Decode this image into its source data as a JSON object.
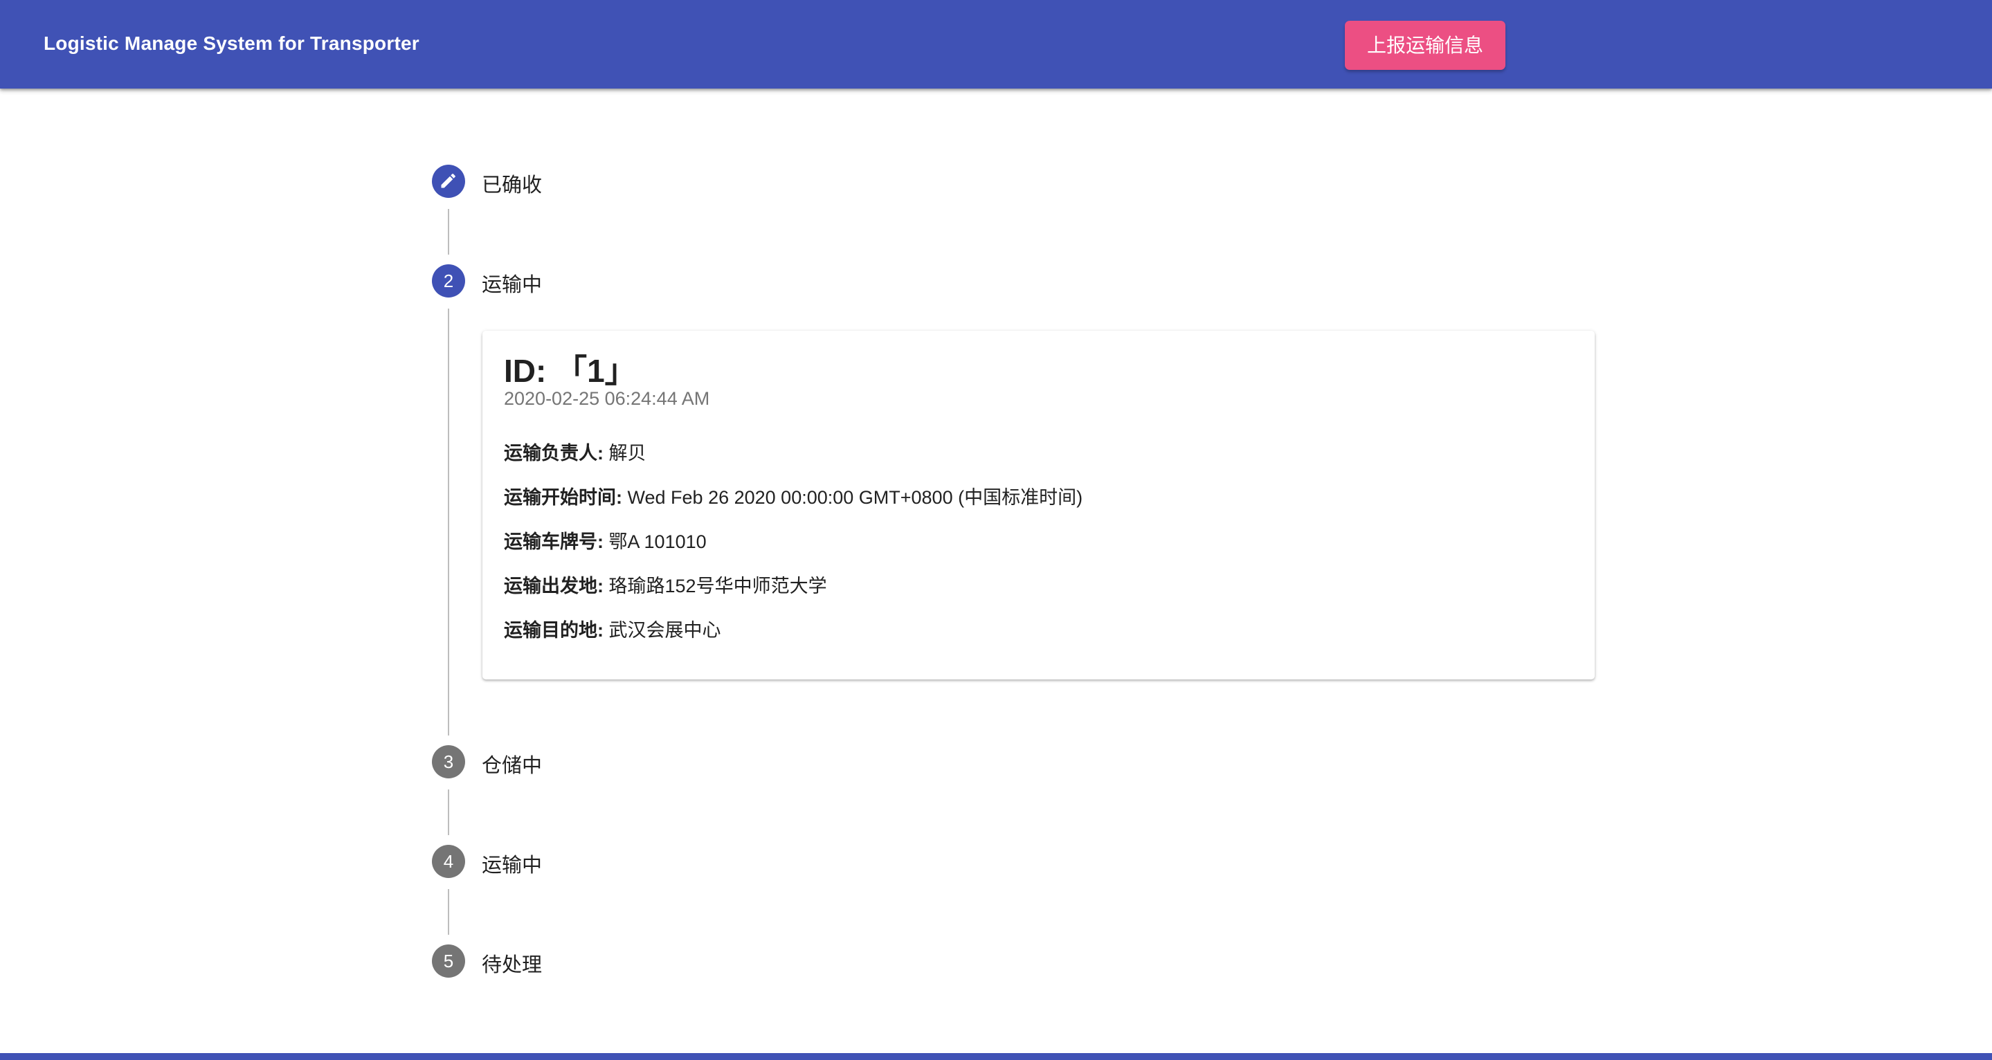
{
  "app": {
    "title": "Logistic Manage System for Transporter",
    "report_button_label": "上报运输信息",
    "brand_color": "#4052b5",
    "accent_color": "#ec4f83"
  },
  "stepper": {
    "current_step": 2,
    "steps": [
      {
        "index": "1",
        "icon": "pencil-icon",
        "label": "已确收",
        "state": "completed"
      },
      {
        "index": "2",
        "label": "运输中",
        "state": "active"
      },
      {
        "index": "3",
        "label": "仓储中",
        "state": "pending"
      },
      {
        "index": "4",
        "label": "运输中",
        "state": "pending"
      },
      {
        "index": "5",
        "label": "待处理",
        "state": "pending"
      }
    ]
  },
  "card": {
    "title": "ID: 「1」",
    "subtitle": "2020-02-25 06:24:44 AM",
    "fields": [
      {
        "key": "运输负责人:",
        "value": "解贝"
      },
      {
        "key": "运输开始时间:",
        "value": "Wed Feb 26 2020 00:00:00 GMT+0800 (中国标准时间)"
      },
      {
        "key": "运输车牌号:",
        "value": "鄂A 101010"
      },
      {
        "key": "运输出发地:",
        "value": "珞瑜路152号华中师范大学"
      },
      {
        "key": "运输目的地:",
        "value": "武汉会展中心"
      }
    ]
  }
}
